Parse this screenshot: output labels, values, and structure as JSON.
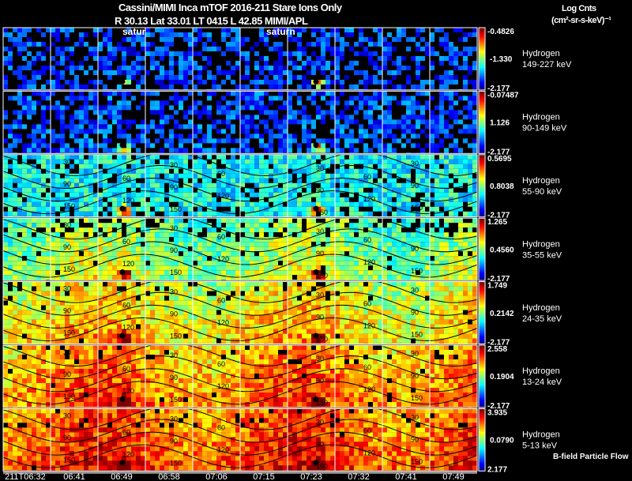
{
  "header": {
    "title": "Cassini/MIMI Inca mTOF  2016-211    Stare    Ions Only",
    "subtitle": "R        30.13 Lat 33.01 LT 0415 L            42.85  MIMI/APL",
    "units_line1": "Log Cnts",
    "units_line2": "(cm²-sr-s-keV)⁻¹",
    "footer_note": "B-field Particle Flow",
    "markers": [
      "satur",
      "saturn"
    ]
  },
  "chart_data": {
    "type": "heatmap",
    "colormap": "jet",
    "x_tick_labels": [
      "211T06:32",
      "06:41",
      "06:49",
      "06:58",
      "07:06",
      "07:15",
      "07:23",
      "07:32",
      "07:41",
      "07:49"
    ],
    "contour_labels": [
      "30",
      "60",
      "90",
      "120",
      "150"
    ],
    "panels": [
      {
        "species": "Hydrogen",
        "energy": "149-227 keV",
        "cb_max": "-0.4826",
        "cb_mid": "-1.330",
        "cb_min": "-2.177"
      },
      {
        "species": "Hydrogen",
        "energy": "90-149 keV",
        "cb_max": "-0.07487",
        "cb_mid": "1.126",
        "cb_min": "-2.177"
      },
      {
        "species": "Hydrogen",
        "energy": "55-90 keV",
        "cb_max": "0.5695",
        "cb_mid": "0.8038",
        "cb_min": "-2.177"
      },
      {
        "species": "Hydrogen",
        "energy": "35-55 keV",
        "cb_max": "1.265",
        "cb_mid": "0.4560",
        "cb_min": "-2.177"
      },
      {
        "species": "Hydrogen",
        "energy": "24-35 keV",
        "cb_max": "1.749",
        "cb_mid": "0.2142",
        "cb_min": "-2.177"
      },
      {
        "species": "Hydrogen",
        "energy": "13-24 keV",
        "cb_max": "2.558",
        "cb_mid": "0.1904",
        "cb_min": "-2.177"
      },
      {
        "species": "Hydrogen",
        "energy": "5-13 keV",
        "cb_max": "3.935",
        "cb_mid": "0.0790",
        "cb_min": "2.177"
      }
    ]
  }
}
